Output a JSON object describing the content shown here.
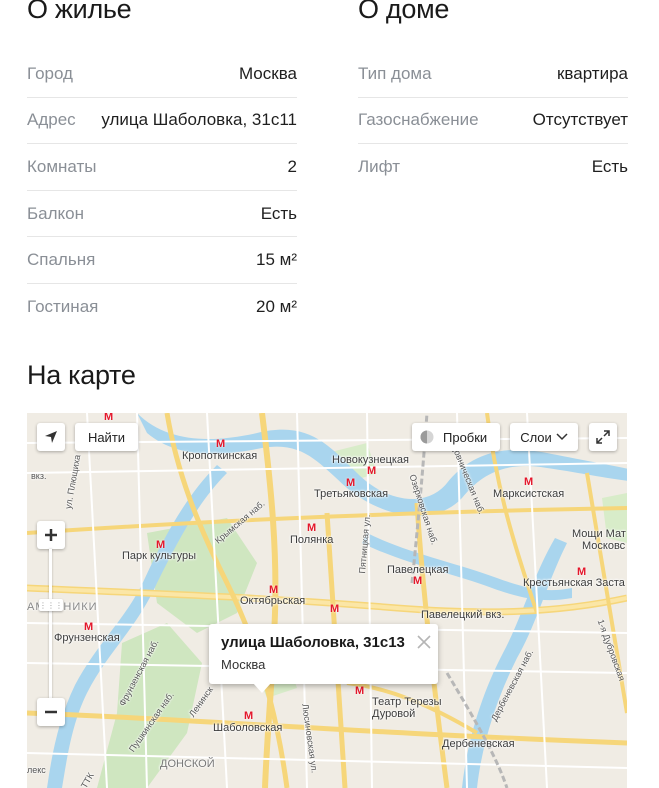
{
  "housing": {
    "title": "О жилье",
    "rows": [
      {
        "label": "Город",
        "value": "Москва"
      },
      {
        "label": "Адрес",
        "value": "улица Шаболовка, 31с11"
      },
      {
        "label": "Комнаты",
        "value": "2"
      },
      {
        "label": "Балкон",
        "value": "Есть"
      },
      {
        "label": "Спальня",
        "value": "15 м²"
      },
      {
        "label": "Гостиная",
        "value": "20 м²"
      }
    ]
  },
  "building": {
    "title": "О доме",
    "rows": [
      {
        "label": "Тип дома",
        "value": "квартира"
      },
      {
        "label": "Газоснабжение",
        "value": "Отсутствует"
      },
      {
        "label": "Лифт",
        "value": "Есть"
      }
    ]
  },
  "map": {
    "title": "На карте",
    "find_label": "Найти",
    "traffic_label": "Пробки",
    "layers_label": "Слои",
    "balloon": {
      "title": "улица Шаболовка, 31с13",
      "subtitle": "Москва"
    },
    "labels": {
      "kropotkinskaya": "Кропоткинская",
      "novokuznetskaya": "Новокузнецкая",
      "tretyakovskaya": "Третьяковская",
      "marksistskaya": "Марксистская",
      "park_kultury": "Парк культуры",
      "polyanka": "Полянка",
      "paveletskaya": "Павелецкая",
      "oktyabrskaya": "Октябрьская",
      "paveletsky_vkz": "Павелецкий вкз.",
      "frunzenskaya": "Фрунзенская",
      "krestyanskaya": "Крестьянская Заста",
      "teatr_durova_1": "Театр Терезы",
      "teatr_durova_2": "Дуровой",
      "derbenevskaya": "Дербеневская",
      "shabolovskaya": "Шаболовская",
      "donskoy": "ДОНСКОЙ",
      "mosque_1": "Мощи Мат",
      "mosque_2": "Московс",
      "khamovniki": "АМОВНИКИ",
      "pyatnitskaya": "Пятницкая ул.",
      "ozerkovskaya": "Озерковская наб.",
      "krymskaya": "Крымская наб.",
      "frunzenskaya_nab": "Фрунзенская наб.",
      "pushkinskaya_nab": "Пушкинская наб.",
      "leninsky": "Ленинск",
      "lyusinovskaya": "Люсиновская ул.",
      "derbenevskaya_nab": "Дербеневская наб.",
      "sadovnicheskaya": "Садовническая наб.",
      "pliushchikha": "ул. Плющиха",
      "vkz": "вкз.",
      "lenin_sm": "лекс",
      "first_ul": "1-я Дубровская",
      "ttk": "ТТК"
    }
  }
}
